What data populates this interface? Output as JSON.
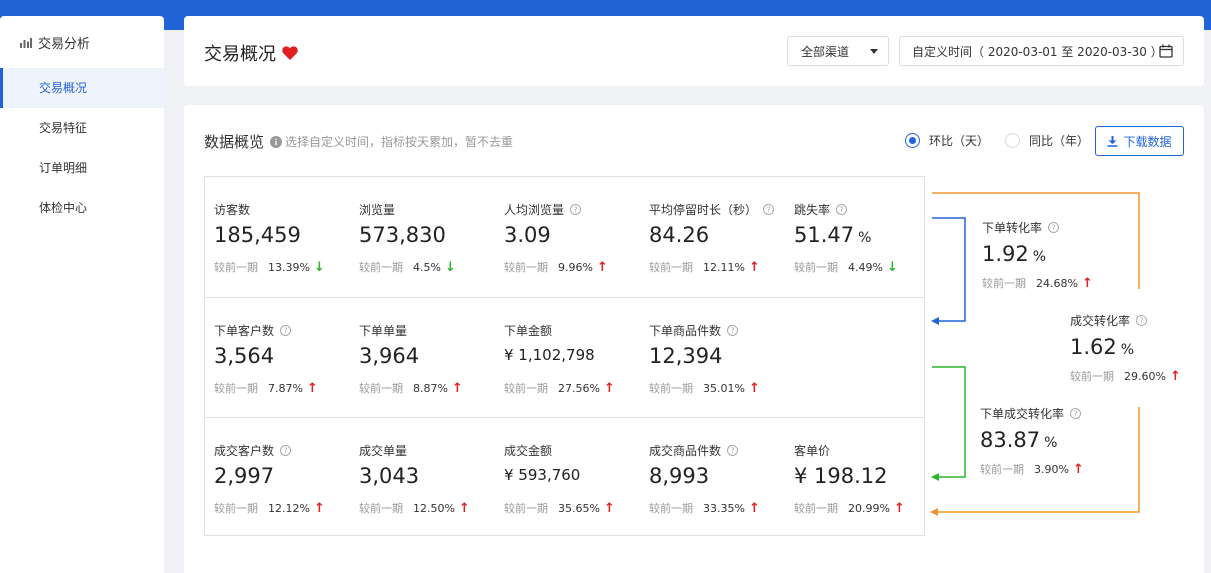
{
  "sidebar": {
    "header": "交易分析",
    "items": [
      "交易概况",
      "交易特征",
      "订单明细",
      "体检中心"
    ]
  },
  "header": {
    "title": "交易概况",
    "channel": "全部渠道",
    "date_range": "自定义时间（ 2020-03-01 至 2020-03-30 ）"
  },
  "overview": {
    "title": "数据概览",
    "hint": "选择自定义时间，指标按天累加，暂不去重",
    "radio_day": "环比（天）",
    "radio_year": "同比（年）",
    "download": "下载数据",
    "compare_label": "较前一期"
  },
  "rows": [
    [
      {
        "label": "访客数",
        "value": "185,459",
        "rate": "13.39%",
        "trend": "down",
        "help": false
      },
      {
        "label": "浏览量",
        "value": "573,830",
        "rate": "4.5%",
        "trend": "down",
        "help": false
      },
      {
        "label": "人均浏览量",
        "value": "3.09",
        "rate": "9.96%",
        "trend": "up",
        "help": true
      },
      {
        "label": "平均停留时长（秒）",
        "value": "84.26",
        "rate": "12.11%",
        "trend": "up",
        "help": true
      },
      {
        "label": "跳失率",
        "value": "51.47",
        "unit": "%",
        "rate": "4.49%",
        "trend": "down",
        "help": true
      }
    ],
    [
      {
        "label": "下单客户数",
        "value": "3,564",
        "rate": "7.87%",
        "trend": "up",
        "help": true
      },
      {
        "label": "下单单量",
        "value": "3,964",
        "rate": "8.87%",
        "trend": "up",
        "help": false
      },
      {
        "label": "下单金额",
        "value": "¥ 1,102,798",
        "rate": "27.56%",
        "trend": "up",
        "help": false,
        "money": true
      },
      {
        "label": "下单商品件数",
        "value": "12,394",
        "rate": "35.01%",
        "trend": "up",
        "help": true
      }
    ],
    [
      {
        "label": "成交客户数",
        "value": "2,997",
        "rate": "12.12%",
        "trend": "up",
        "help": true
      },
      {
        "label": "成交单量",
        "value": "3,043",
        "rate": "12.50%",
        "trend": "up",
        "help": false
      },
      {
        "label": "成交金额",
        "value": "¥ 593,760",
        "rate": "35.65%",
        "trend": "up",
        "help": false,
        "money": true
      },
      {
        "label": "成交商品件数",
        "value": "8,993",
        "rate": "33.35%",
        "trend": "up",
        "help": true
      },
      {
        "label": "客单价",
        "value": "¥ 198.12",
        "rate": "20.99%",
        "trend": "up",
        "help": false
      }
    ]
  ],
  "flow": [
    {
      "label": "下单转化率",
      "value": "1.92",
      "unit": "%",
      "rate": "24.68%",
      "trend": "up"
    },
    {
      "label": "成交转化率",
      "value": "1.62",
      "unit": "%",
      "rate": "29.60%",
      "trend": "up"
    },
    {
      "label": "下单成交转化率",
      "value": "83.87",
      "unit": "%",
      "rate": "3.90%",
      "trend": "up"
    }
  ],
  "colors": {
    "accent": "#2264d8",
    "up": "#e02020",
    "down": "#2db52d",
    "orange": "#f0962d",
    "green": "#2db52d"
  }
}
